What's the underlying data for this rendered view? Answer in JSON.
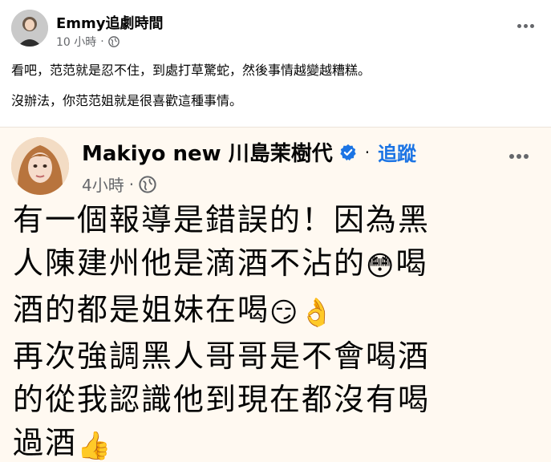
{
  "post": {
    "author": "Emmy追劇時間",
    "time": "10 小時",
    "dot": "·",
    "body_lines": [
      "看吧，范范就是忍不住，到處打草驚蛇，然後事情越變越糟糕。",
      "沒辦法，你范范姐就是很喜歡這種事情。"
    ]
  },
  "shared": {
    "author": "Makiyo new 川島茉樹代",
    "separator": "·",
    "follow_label": "追蹤",
    "time": "4小時",
    "dot": "·",
    "lines": [
      {
        "text": "有一個報導是錯誤的！因為黑",
        "emoji": ""
      },
      {
        "text": "人陳建州他是滴酒不沾的",
        "emoji": "😳",
        "after": "喝"
      },
      {
        "text": "酒的都是姐妹在喝",
        "emoji": "😏👌",
        "after": ""
      },
      {
        "text": "再次強調黑人哥哥是不會喝酒",
        "emoji": ""
      },
      {
        "text": "的從我認識他到現在都沒有喝",
        "emoji": ""
      },
      {
        "text": "過酒",
        "emoji": "👍",
        "after": ""
      }
    ]
  },
  "icons": {
    "globe": "globe-icon",
    "more": "more-options-icon",
    "verified": "verified-badge-icon"
  },
  "colors": {
    "accent": "#1b74e4",
    "shared_bg": "#fff9f1",
    "meta": "#65676b"
  }
}
